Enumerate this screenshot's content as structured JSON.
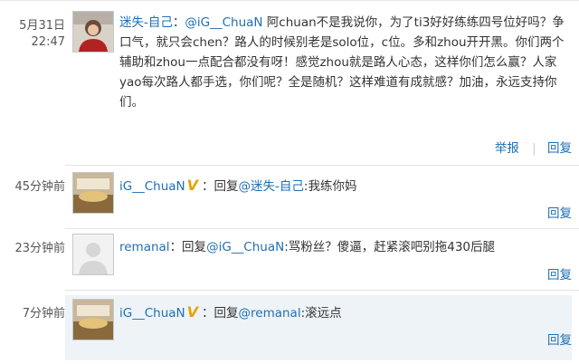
{
  "comments": [
    {
      "time_line1": "5月31日",
      "time_line2": "22:47",
      "author": "迷失-自己",
      "author_suffix": "：",
      "mention": "@iG__ChuaN",
      "text": "阿chuan不是我说你，为了ti3好好练练四号位好吗？争口气，就只会chen？路人的时候别老是solo位，c位。多和zhou开开黑。你们两个辅助和zhou一点配合都没有呀！感觉zhou就是路人心态，这样你们怎么赢？人家yao每次路人都手选，你们呢？全是随机？这样难道有成就感？加油，永远支持你们。",
      "report_label": "举报",
      "reply_label": "回复"
    },
    {
      "time": "45分钟前",
      "author": "iG__ChuaN",
      "verified": "V",
      "prefix": "：回复",
      "mention": "@迷失-自己",
      "text": ":我练你妈",
      "reply_label": "回复"
    },
    {
      "time": "23分钟前",
      "author": "remanal",
      "prefix": "：回复",
      "mention": "@iG__ChuaN",
      "text": ":骂粉丝？傻逼，赶紧滚吧别拖430后腿",
      "reply_label": "回复"
    },
    {
      "time": "7分钟前",
      "author": "iG__ChuaN",
      "verified": "V",
      "prefix": "：回复",
      "mention": "@remanal",
      "text": ":滚远点",
      "reply_label": "回复"
    }
  ],
  "colors": {
    "link": "#1f6fb4",
    "verified": "#e8a200",
    "highlight_bg": "#eef3f7"
  }
}
